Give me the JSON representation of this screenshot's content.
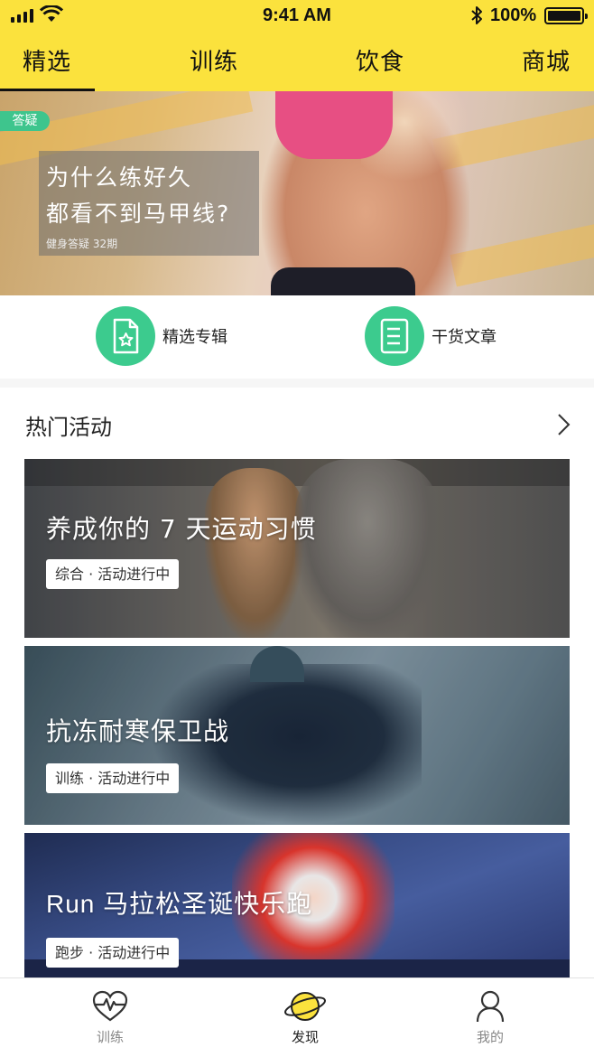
{
  "status_bar": {
    "time": "9:41 AM",
    "battery": "100%"
  },
  "top_tabs": [
    {
      "label": "精选",
      "active": true
    },
    {
      "label": "训练",
      "active": false
    },
    {
      "label": "饮食",
      "active": false
    },
    {
      "label": "商城",
      "active": false
    }
  ],
  "hero": {
    "badge": "答疑",
    "title_line1": "为什么练好久",
    "title_line2": "都看不到马甲线?",
    "subtitle": "健身答疑 32期"
  },
  "quick_entries": [
    {
      "label": "精选专辑",
      "icon": "star-document-icon"
    },
    {
      "label": "干货文章",
      "icon": "article-list-icon"
    }
  ],
  "hot_activities": {
    "title": "热门活动",
    "cards": [
      {
        "title": "养成你的 7 天运动习惯",
        "tag": "综合 · 活动进行中"
      },
      {
        "title": "抗冻耐寒保卫战",
        "tag": "训练 · 活动进行中"
      },
      {
        "title": "Run 马拉松圣诞快乐跑",
        "tag": "跑步 · 活动进行中"
      }
    ]
  },
  "bottom_tabs": [
    {
      "label": "训练",
      "icon": "heartbeat-icon",
      "active": false
    },
    {
      "label": "发现",
      "icon": "planet-icon",
      "active": true
    },
    {
      "label": "我的",
      "icon": "person-icon",
      "active": false
    }
  ],
  "colors": {
    "header_yellow": "#fbe23d",
    "accent_green": "#3ccb8e",
    "badge_green": "#3ec58d"
  }
}
